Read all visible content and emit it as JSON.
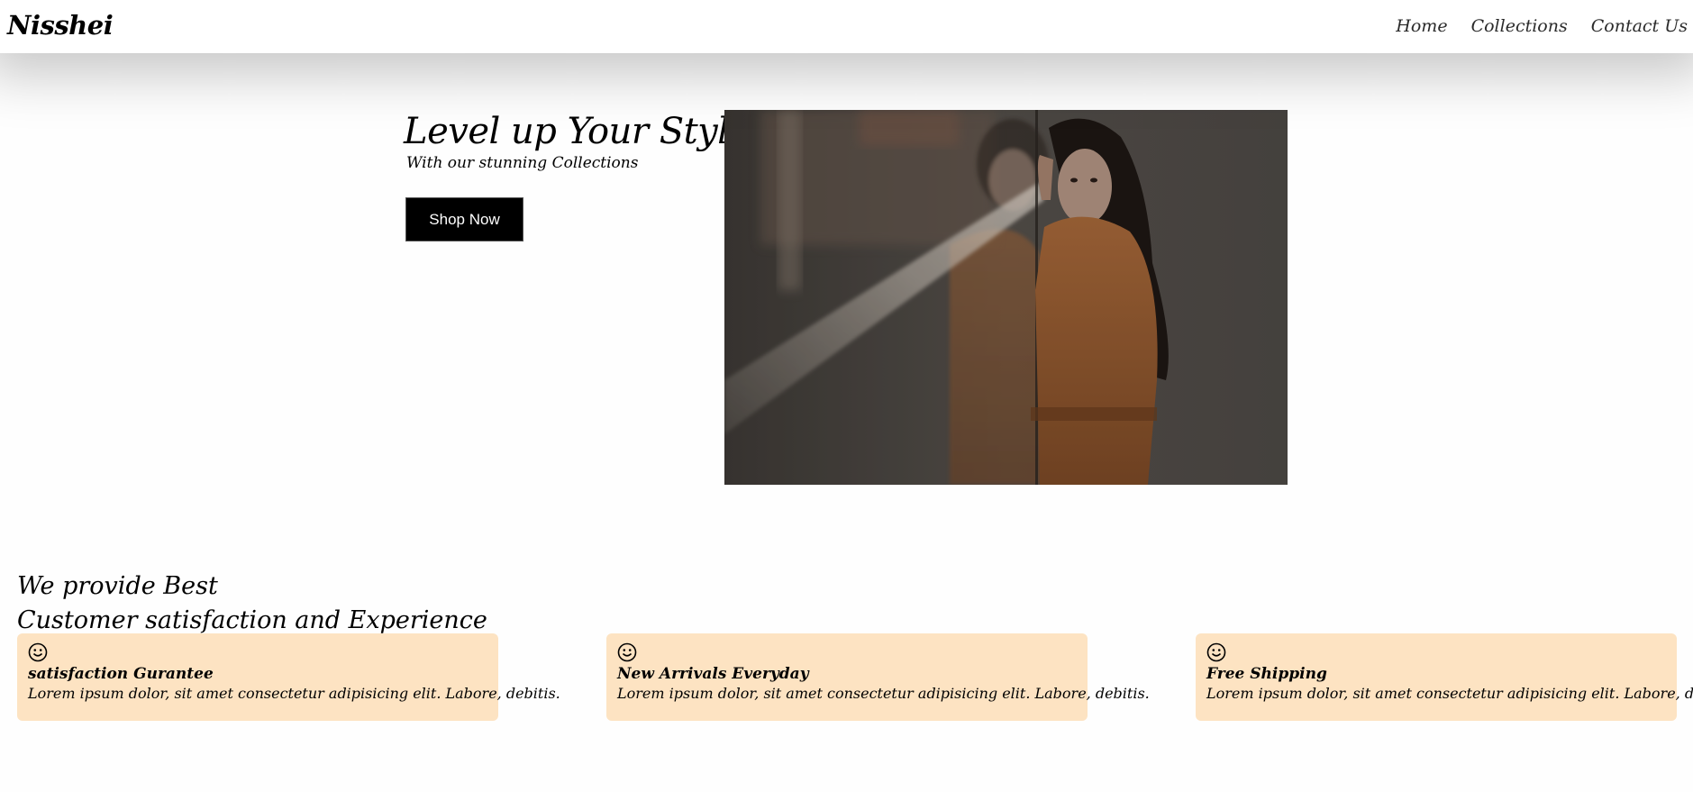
{
  "header": {
    "brand": "Nisshei",
    "nav": [
      {
        "label": "Home"
      },
      {
        "label": "Collections"
      },
      {
        "label": "Contact Us"
      }
    ]
  },
  "hero": {
    "title": "Level up Your Style",
    "subtitle": "With our stunning Collections",
    "cta_label": "Shop Now",
    "image_colors": {
      "background": "#4a4541",
      "coat": "#9a5f32",
      "hair": "#1e1714"
    }
  },
  "features": {
    "heading_line1": "We provide Best",
    "heading_line2": "Customer satisfaction and Experience",
    "cards": [
      {
        "icon": "smiley-icon",
        "title": "satisfaction Gurantee",
        "text": "Lorem ipsum dolor, sit amet consectetur adipisicing elit. Labore, debitis."
      },
      {
        "icon": "smiley-icon",
        "title": "New Arrivals Everyday",
        "text": "Lorem ipsum dolor, sit amet consectetur adipisicing elit. Labore, debitis."
      },
      {
        "icon": "smiley-icon",
        "title": "Free Shipping",
        "text": "Lorem ipsum dolor, sit amet consectetur adipisicing elit. Labore, debitis."
      }
    ],
    "card_color": "#fde3c2"
  }
}
